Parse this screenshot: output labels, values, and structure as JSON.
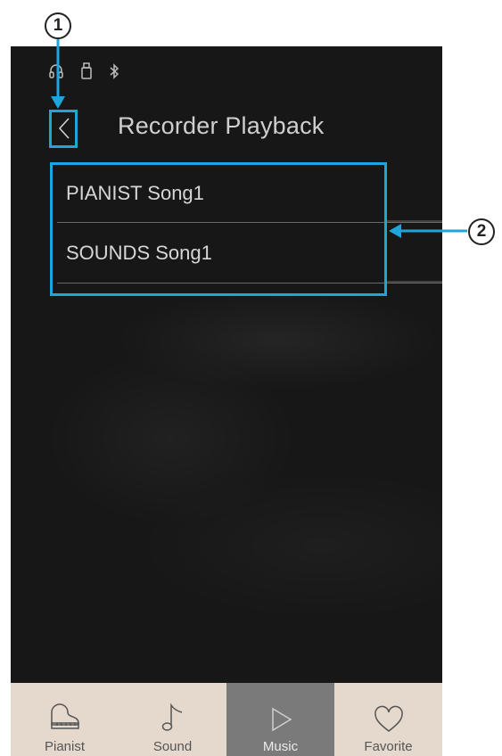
{
  "header": {
    "title": "Recorder Playback"
  },
  "status_icons": [
    "headphones-icon",
    "usb-icon",
    "bluetooth-icon"
  ],
  "list": {
    "items": [
      {
        "label": "PIANIST Song1"
      },
      {
        "label": "SOUNDS Song1"
      }
    ]
  },
  "tabs": [
    {
      "label": "Pianist",
      "icon": "grand-piano-icon",
      "active": false
    },
    {
      "label": "Sound",
      "icon": "music-note-icon",
      "active": false
    },
    {
      "label": "Music",
      "icon": "play-icon",
      "active": true
    },
    {
      "label": "Favorite",
      "icon": "heart-icon",
      "active": false
    }
  ],
  "annotations": {
    "marker_1": "1",
    "marker_2": "2"
  },
  "colors": {
    "highlight": "#1ea5d9",
    "screen_bg": "#171717",
    "tab_bg": "#e5d9cd",
    "tab_active_bg": "#7a7a7a"
  }
}
